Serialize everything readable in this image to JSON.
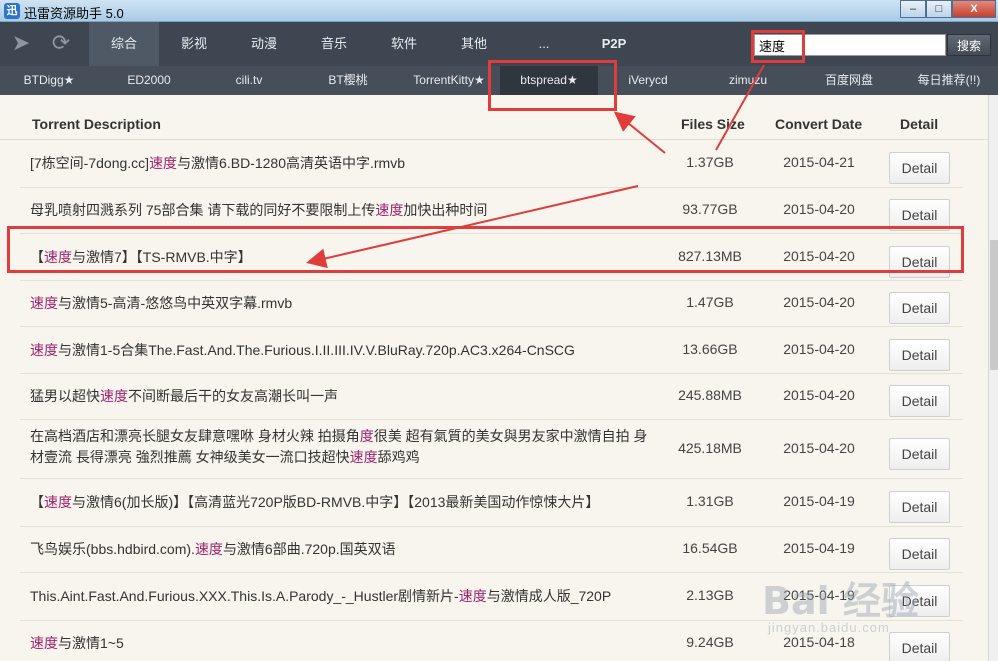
{
  "window": {
    "title": "迅雷资源助手 5.0",
    "buttons": [
      "–",
      "□",
      "X"
    ]
  },
  "topnav": {
    "tabs": [
      "综合",
      "影视",
      "动漫",
      "音乐",
      "软件",
      "其他",
      "...",
      "P2P"
    ],
    "active_tab": "综合",
    "search_value": "速度",
    "search_button": "搜索"
  },
  "subnav": {
    "tabs": [
      "BTDigg★",
      "ED2000",
      "cili.tv",
      "BT樱桃",
      "TorrentKitty★",
      "btspread★",
      "iVerycd",
      "zimuzu",
      "百度网盘",
      "每日推荐(!!)"
    ],
    "active_tab": "btspread★"
  },
  "table": {
    "headers": [
      "Torrent Description",
      "Files Size",
      "Convert Date",
      "Detail"
    ],
    "detail_label": "Detail",
    "rows": [
      {
        "parts": [
          "[7栋空间-7dong.cc]",
          "速度",
          "与激情6.BD-1280高清英语中字.rmvb"
        ],
        "size": "1.37GB",
        "date": "2015-04-21"
      },
      {
        "parts": [
          "母乳喷射四溅系列 75部合集 请下载的同好不要限制上传",
          "速度",
          "加快出种时间"
        ],
        "size": "93.77GB",
        "date": "2015-04-20"
      },
      {
        "parts": [
          "【",
          "速度",
          "与激情7】【TS-RMVB.中字】"
        ],
        "size": "827.13MB",
        "date": "2015-04-20"
      },
      {
        "parts": [
          "",
          "速度",
          "与激情5-高清-悠悠鸟中英双字幕.rmvb"
        ],
        "size": "1.47GB",
        "date": "2015-04-20"
      },
      {
        "parts": [
          "",
          "速度",
          "与激情1-5合集The.Fast.And.The.Furious.I.II.III.IV.V.BluRay.720p.AC3.x264-CnSCG"
        ],
        "size": "13.66GB",
        "date": "2015-04-20"
      },
      {
        "parts": [
          "猛男以超快",
          "速度",
          "不间断最后干的女友高潮长叫一声"
        ],
        "size": "245.88MB",
        "date": "2015-04-20"
      },
      {
        "parts": [
          "在高档酒店和漂亮长腿女友肆意嘿咻 身材火辣 拍摄角",
          "度",
          "很美 超有氣質的美女與男友家中激情自拍 身材壹流 長得漂亮 強烈推薦 女神级美女一流口技超快",
          "速度",
          "舔鸡鸡"
        ],
        "size": "425.18MB",
        "date": "2015-04-20"
      },
      {
        "parts": [
          "【",
          "速度",
          "与激情6(加长版)】【高清蓝光720P版BD-RMVB.中字】【2013最新美国动作惊悚大片】"
        ],
        "size": "1.31GB",
        "date": "2015-04-19"
      },
      {
        "parts": [
          "飞鸟娱乐(bbs.hdbird.com).",
          "速度",
          "与激情6部曲.720p.国英双语"
        ],
        "size": "16.54GB",
        "date": "2015-04-19"
      },
      {
        "parts": [
          "This.Aint.Fast.And.Furious.XXX.This.Is.A.Parody_-_Hustler剧情新片-",
          "速度",
          "与激情成人版_720P"
        ],
        "size": "2.13GB",
        "date": "2015-04-19"
      },
      {
        "parts": [
          "",
          "速度",
          "与激情1~5"
        ],
        "size": "9.24GB",
        "date": "2015-04-18"
      }
    ]
  },
  "watermark": {
    "logo": "Bai 经验",
    "url": "jingyan.baidu.com"
  },
  "colors": {
    "highlight": "#a0226d",
    "annotation": "#e03c3c",
    "nav_bg": "#3d4651"
  }
}
